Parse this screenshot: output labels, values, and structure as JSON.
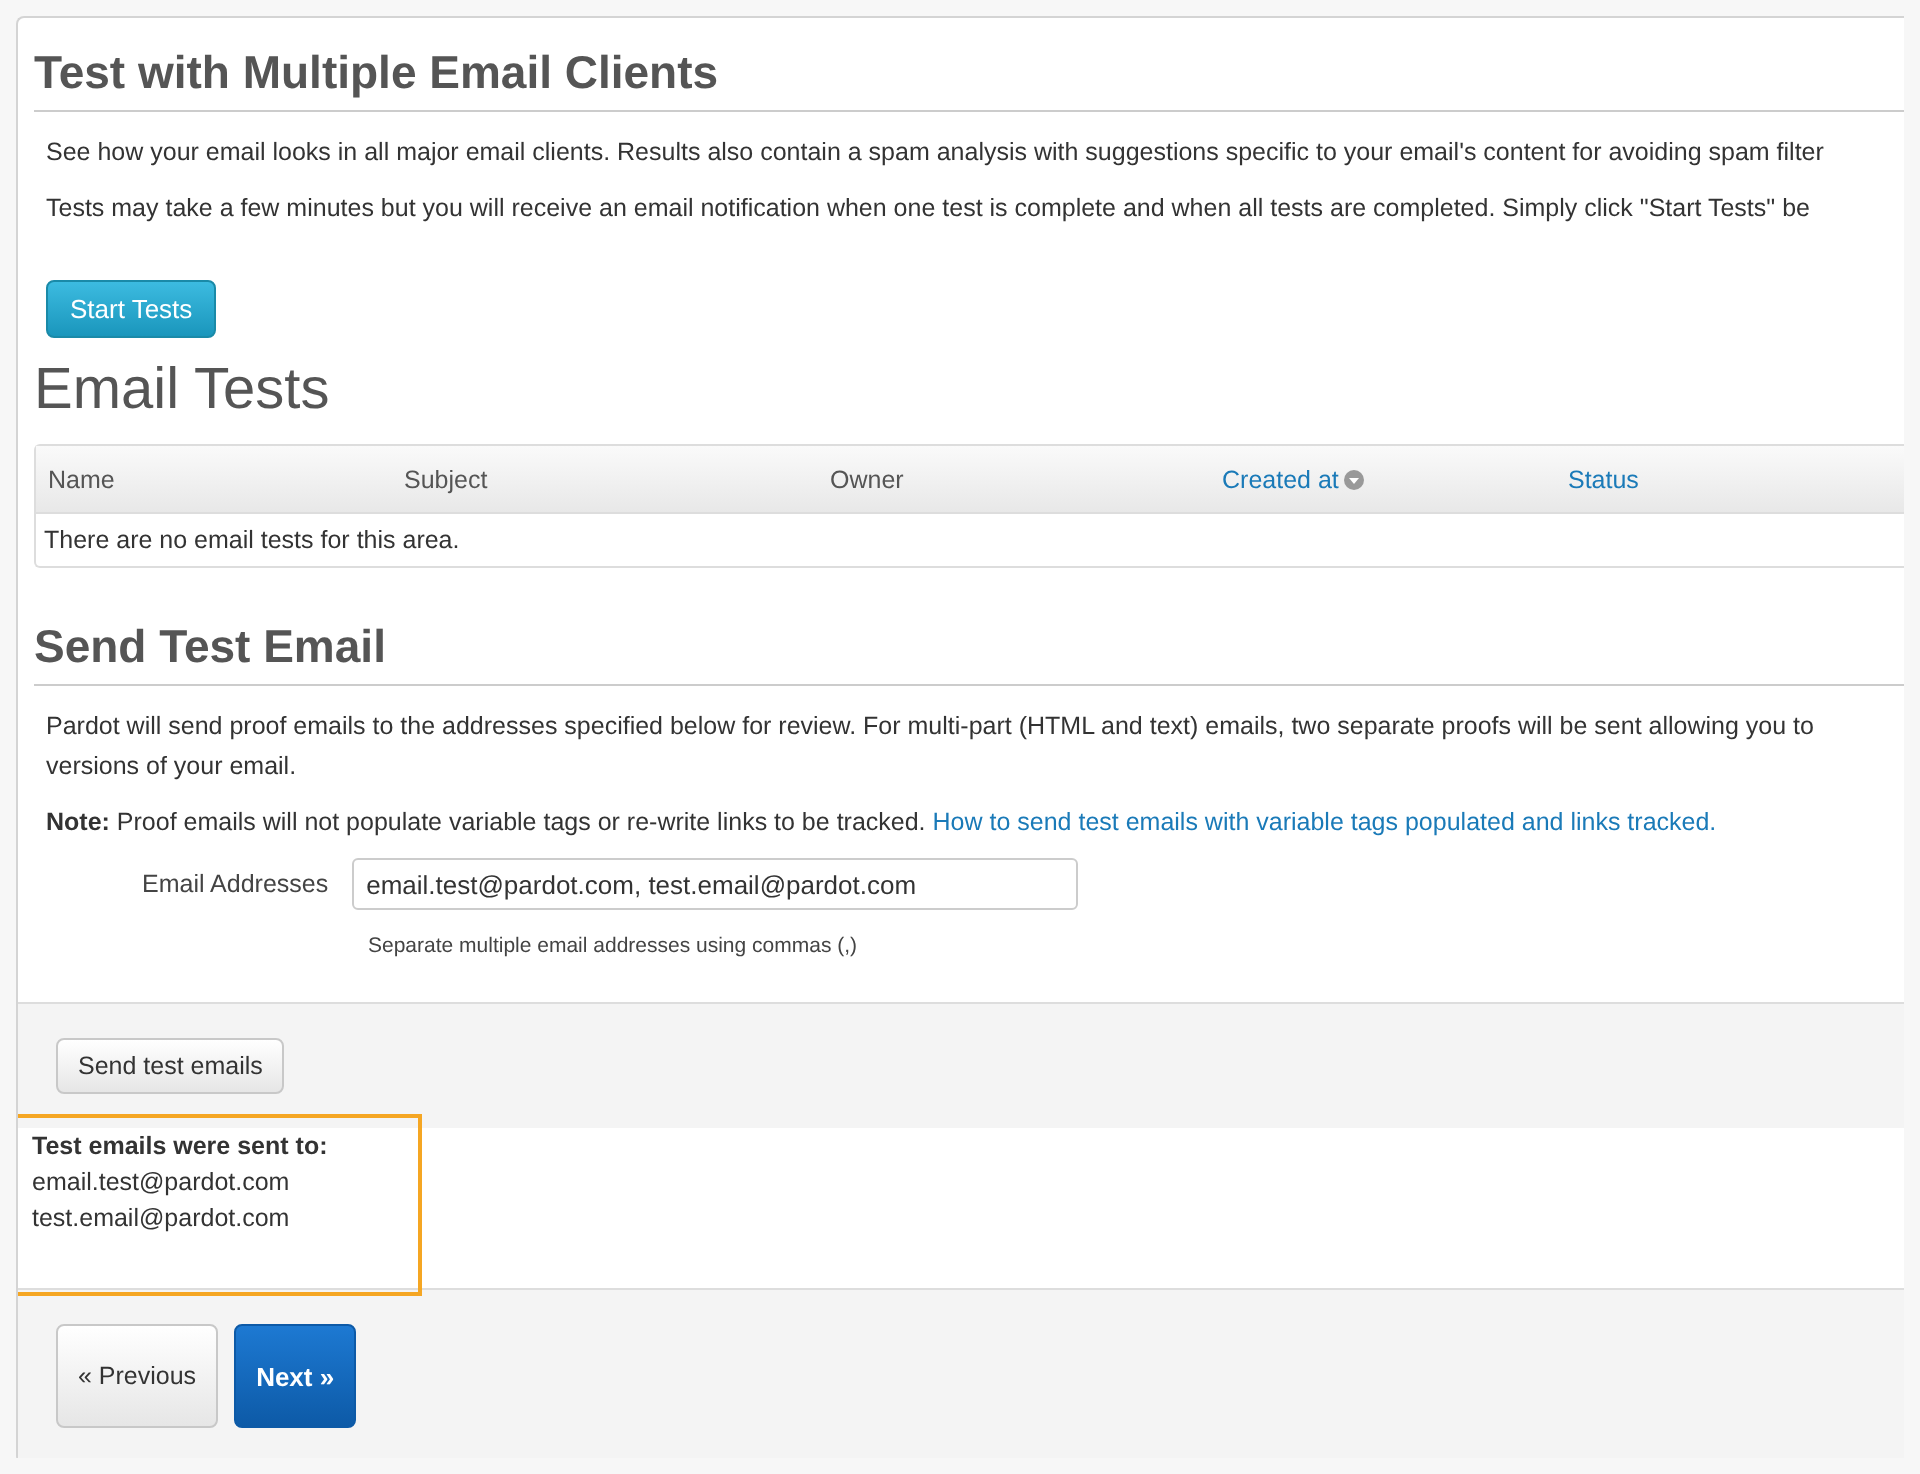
{
  "title": "Test with Multiple Email Clients",
  "intro": [
    "See how your email looks in all major email clients. Results also contain a spam analysis with suggestions specific to your email's content for avoiding spam filter",
    "Tests may take a few minutes but you will receive an email notification when one test is complete and when all tests are completed. Simply click \"Start Tests\" be"
  ],
  "start_button": "Start Tests",
  "tests": {
    "title": "Email Tests",
    "columns": [
      {
        "label": "Name",
        "sortable": false,
        "sorted": false
      },
      {
        "label": "Subject",
        "sortable": false,
        "sorted": false
      },
      {
        "label": "Owner",
        "sortable": false,
        "sorted": false
      },
      {
        "label": "Created at",
        "sortable": true,
        "sorted": true
      },
      {
        "label": "Status",
        "sortable": true,
        "sorted": false
      }
    ],
    "empty": "There are no email tests for this area."
  },
  "send": {
    "title": "Send Test Email",
    "description": [
      "Pardot will send proof emails to the addresses specified below for review. For multi-part (HTML and text) emails, two separate proofs will be sent allowing you to",
      "versions of your email."
    ],
    "note": "**Note:** Proof emails will not populate variable tags or re-write links to be tracked.",
    "note_link": "How to send test emails with variable tags populated and links tracked.",
    "field_label": "Email Addresses",
    "field_value": "email.test@pardot.com, test.email@pardot.com",
    "field_help": "Separate multiple email addresses using commas (,)",
    "send_button": "Send test emails"
  },
  "result": {
    "heading": "Test emails were sent to:",
    "emails": [
      "email.test@pardot.com",
      "test.email@pardot.com"
    ]
  },
  "nav": {
    "previous": "« Previous",
    "next": "Next »"
  }
}
